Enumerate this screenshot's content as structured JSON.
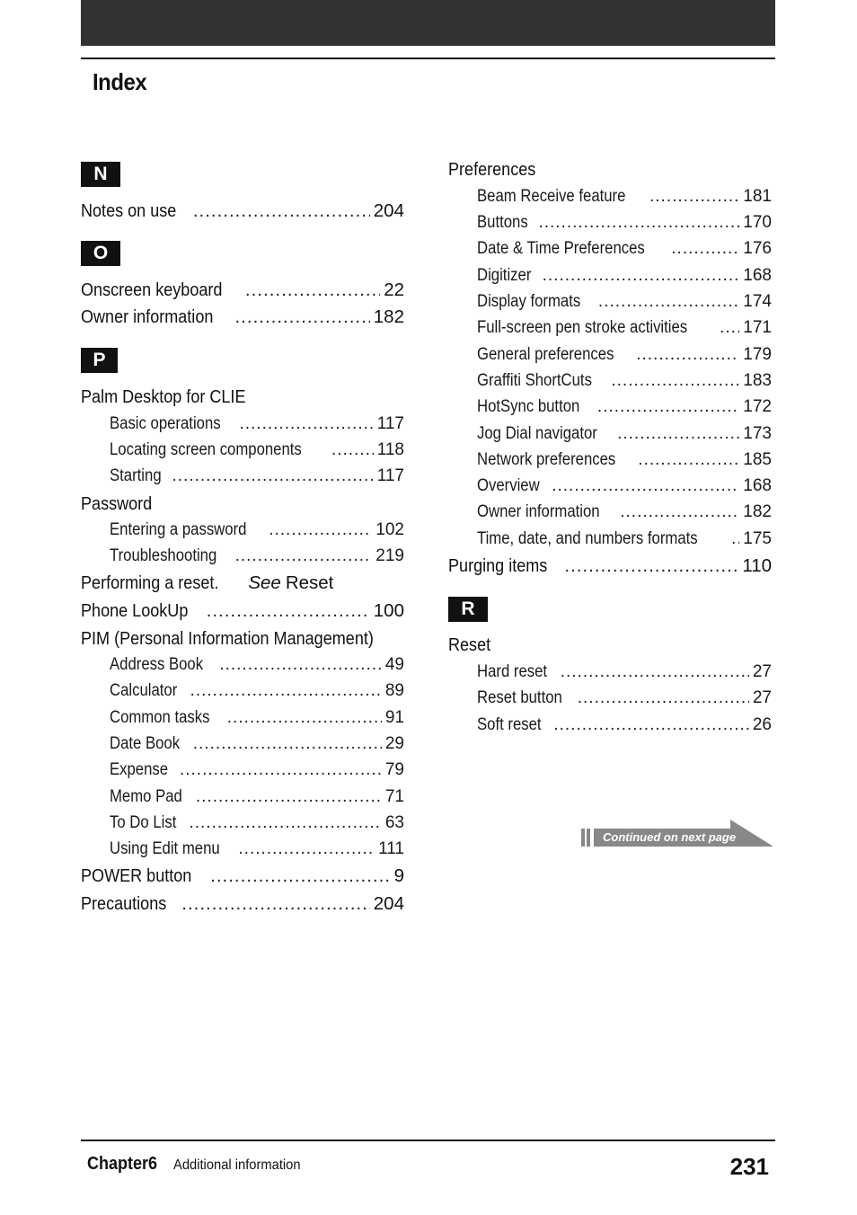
{
  "header": {
    "title": "Index"
  },
  "left_column": {
    "sections": [
      {
        "letter": "N",
        "entries": [
          {
            "label": "Notes on use",
            "page": "204",
            "level": 0
          }
        ]
      },
      {
        "letter": "O",
        "entries": [
          {
            "label": "Onscreen keyboard",
            "page": "22",
            "level": 0
          },
          {
            "label": "Owner information",
            "page": "182",
            "level": 0
          }
        ]
      },
      {
        "letter": "P",
        "entries": [
          {
            "label": "Palm Desktop for CLIE",
            "page": null,
            "level": 0
          },
          {
            "label": "Basic operations",
            "page": "117",
            "level": 1
          },
          {
            "label": "Locating screen components",
            "page": "118",
            "level": 1
          },
          {
            "label": "Starting",
            "page": "117",
            "level": 1
          },
          {
            "label": "Password",
            "page": null,
            "level": 0
          },
          {
            "label": "Entering a password",
            "page": "102",
            "level": 1
          },
          {
            "label": "Troubleshooting",
            "page": "219",
            "level": 1
          },
          {
            "label": "Performing a reset.",
            "see": "See",
            "see_target": "Reset",
            "page": null,
            "level": 0
          },
          {
            "label": "Phone LookUp",
            "page": "100",
            "level": 0
          },
          {
            "label": "PIM (Personal Information Management)",
            "page": null,
            "level": 0
          },
          {
            "label": "Address Book",
            "page": "49",
            "level": 1
          },
          {
            "label": "Calculator",
            "page": "89",
            "level": 1
          },
          {
            "label": "Common tasks",
            "page": "91",
            "level": 1
          },
          {
            "label": "Date Book",
            "page": "29",
            "level": 1
          },
          {
            "label": "Expense",
            "page": "79",
            "level": 1
          },
          {
            "label": "Memo Pad",
            "page": "71",
            "level": 1
          },
          {
            "label": "To Do List",
            "page": "63",
            "level": 1
          },
          {
            "label": "Using Edit menu",
            "page": "111",
            "level": 1
          },
          {
            "label": "POWER button",
            "page": "9",
            "level": 0
          },
          {
            "label": "Precautions",
            "page": "204",
            "level": 0
          }
        ]
      }
    ]
  },
  "right_column": {
    "sections": [
      {
        "letter": null,
        "entries": [
          {
            "label": "Preferences",
            "page": null,
            "level": 0
          },
          {
            "label": "Beam Receive feature",
            "page": "181",
            "level": 1
          },
          {
            "label": "Buttons",
            "page": "170",
            "level": 1
          },
          {
            "label": "Date & Time Preferences",
            "page": "176",
            "level": 1
          },
          {
            "label": "Digitizer",
            "page": "168",
            "level": 1
          },
          {
            "label": "Display formats",
            "page": "174",
            "level": 1
          },
          {
            "label": "Full-screen pen stroke activities",
            "page": "171",
            "level": 1
          },
          {
            "label": "General preferences",
            "page": "179",
            "level": 1
          },
          {
            "label": "Graffiti ShortCuts",
            "page": "183",
            "level": 1
          },
          {
            "label": "HotSync button",
            "page": "172",
            "level": 1
          },
          {
            "label": "Jog Dial navigator",
            "page": "173",
            "level": 1
          },
          {
            "label": "Network preferences",
            "page": "185",
            "level": 1
          },
          {
            "label": "Overview",
            "page": "168",
            "level": 1
          },
          {
            "label": "Owner information",
            "page": "182",
            "level": 1
          },
          {
            "label": "Time, date, and numbers formats",
            "page": "175",
            "level": 1
          },
          {
            "label": "Purging items",
            "page": "110",
            "level": 0
          }
        ]
      },
      {
        "letter": "R",
        "entries": [
          {
            "label": "Reset",
            "page": null,
            "level": 0
          },
          {
            "label": "Hard reset",
            "page": "27",
            "level": 1
          },
          {
            "label": "Reset button",
            "page": "27",
            "level": 1
          },
          {
            "label": "Soft reset",
            "page": "26",
            "level": 1
          }
        ]
      }
    ]
  },
  "continued_banner": {
    "text": "Continued on next page",
    "color": "#888888"
  },
  "footer": {
    "chapter": "Chapter6",
    "section": "Additional information",
    "page_number": "231"
  },
  "colors": {
    "top_bar": "#333333",
    "badge_bg": "#111111",
    "badge_text": "#ffffff",
    "text": "#111111"
  }
}
